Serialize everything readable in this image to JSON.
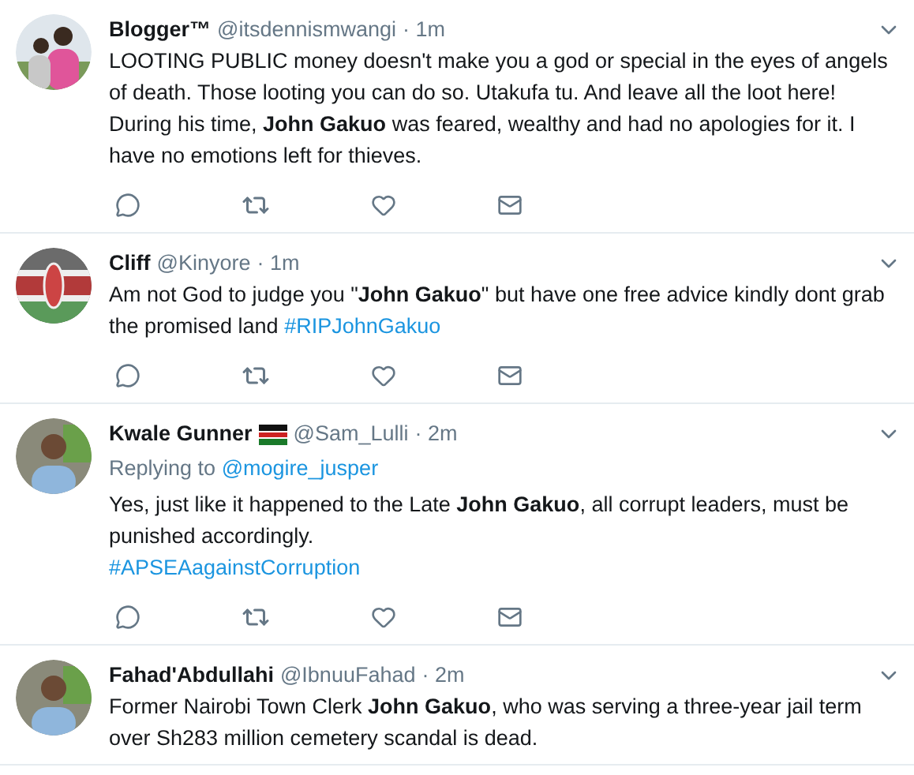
{
  "tweets": [
    {
      "name": "Blogger™",
      "handle": "@itsdennismwangi",
      "time": "· 1m",
      "flag": false,
      "body": "LOOTING PUBLIC money doesn't make you a god or special in the eyes of angels of death. Those looting you can do so. Utakufa tu. And leave all the loot here! During his time, **John Gakuo** was feared, wealthy and had no apologies for it. I have no emotions left for thieves.",
      "actions": true
    },
    {
      "name": "Cliff",
      "handle": "@Kinyore",
      "time": "· 1m",
      "flag": false,
      "body": "Am not God to judge you \"**John Gakuo**\" but have one free advice kindly dont grab the promised land",
      "hashtag": {
        "text": "#RIPJohnGakuo",
        "own_line": false
      },
      "actions": true
    },
    {
      "name": "Kwale Gunner",
      "handle": "@Sam_Lulli",
      "time": "· 2m",
      "flag": true,
      "reply": {
        "label": "Replying to",
        "user": "@mogire_jusper"
      },
      "body": "Yes, just like it happened to the Late **John Gakuo**, all corrupt leaders, must be punished accordingly.",
      "hashtag": {
        "text": "#APSEAagainstCorruption",
        "own_line": true
      },
      "actions": true
    },
    {
      "name": "Fahad'Abdullahi",
      "handle": "@IbnuuFahad",
      "time": "· 2m",
      "flag": false,
      "body": "Former Nairobi Town Clerk **John Gakuo**, who was serving a three-year jail term over Sh283 million cemetery scandal is dead.",
      "actions": false
    }
  ]
}
